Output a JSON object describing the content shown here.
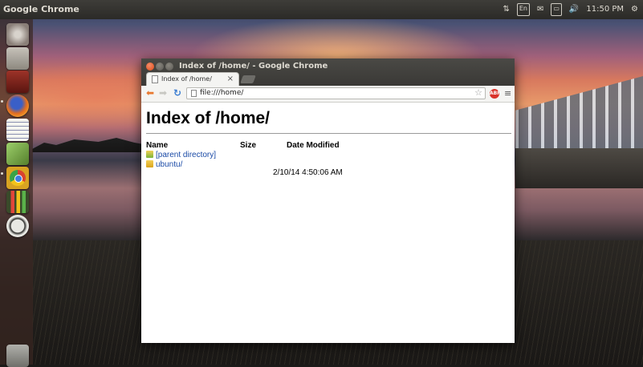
{
  "panel": {
    "app_title": "Google Chrome",
    "indicators": {
      "keyboard_layout": "En",
      "time": "11:50 PM"
    }
  },
  "launcher": {
    "items": [
      {
        "name": "dash-home",
        "icon": "ubuntu-logo-icon",
        "color": "#8a7f78"
      },
      {
        "name": "files",
        "icon": "files-icon",
        "color": "#9a958c"
      },
      {
        "name": "terminal",
        "icon": "terminal-icon",
        "color": "#7a1f1f"
      },
      {
        "name": "firefox",
        "icon": "firefox-icon",
        "color": "#e36d1f"
      },
      {
        "name": "text-editor",
        "icon": "text-editor-icon",
        "color": "#e5e5e0"
      },
      {
        "name": "tools",
        "icon": "tools-icon",
        "color": "#6f9a4a"
      },
      {
        "name": "google-chrome",
        "icon": "chrome-icon",
        "color": "#d9432f"
      },
      {
        "name": "system-monitor",
        "icon": "system-monitor-icon",
        "color": "#2f3b24"
      },
      {
        "name": "software-center",
        "icon": "software-center-icon",
        "color": "#d8d8d3"
      },
      {
        "name": "trash",
        "icon": "trash-icon",
        "color": "#8c8c87"
      }
    ]
  },
  "window": {
    "title": "Index of /home/ - Google Chrome",
    "tab": {
      "title": "Index of /home/",
      "close": "×"
    },
    "address": "file:///home/",
    "adblock_label": "ABP"
  },
  "page": {
    "heading": "Index of /home/",
    "columns": {
      "name": "Name",
      "size": "Size",
      "date": "Date Modified"
    },
    "rows": [
      {
        "name": "[parent directory]",
        "size": "",
        "date": ""
      },
      {
        "name": "ubuntu/",
        "size": "",
        "date": "2/10/14 4:50:06 AM"
      }
    ]
  }
}
